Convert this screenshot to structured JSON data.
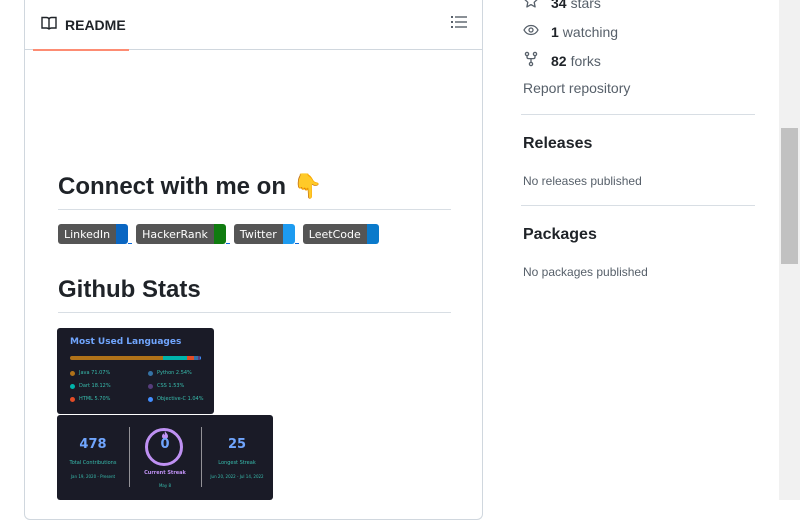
{
  "readme": {
    "tab_label": "README",
    "icons": {
      "book": "book-icon",
      "outline": "list-unordered-icon"
    }
  },
  "content": {
    "connect_heading": "Connect with me on 👇",
    "stats_heading": "Github Stats",
    "badges": [
      {
        "label": "LinkedIn",
        "color": "#0a66c2"
      },
      {
        "label": "HackerRank",
        "color": "#107c10"
      },
      {
        "label": "Twitter",
        "color": "#1d9bf0"
      },
      {
        "label": "LeetCode",
        "color": "#0a7acb"
      }
    ]
  },
  "languages_card": {
    "title": "Most Used Languages",
    "bar": [
      {
        "name": "Java",
        "percent": 71.07,
        "color": "#b07219"
      },
      {
        "name": "Dart",
        "percent": 18.12,
        "color": "#00b4ab"
      },
      {
        "name": "HTML",
        "percent": 5.7,
        "color": "#e34c26"
      },
      {
        "name": "Python",
        "percent": 2.54,
        "color": "#3572a5"
      },
      {
        "name": "CSS",
        "percent": 1.53,
        "color": "#563d7c"
      },
      {
        "name": "Objective-C",
        "percent": 1.04,
        "color": "#438eff"
      }
    ],
    "items": [
      "Java 71.07%",
      "Python 2.54%",
      "Dart 18.12%",
      "CSS 1.53%",
      "HTML 5.70%",
      "Objective-C 1.04%"
    ]
  },
  "streak_card": {
    "total": {
      "value": "478",
      "label": "Total Contributions",
      "range": "Jan 19, 2020 - Present"
    },
    "current": {
      "value": "0",
      "label": "Current Streak",
      "range": "May 8"
    },
    "longest": {
      "value": "25",
      "label": "Longest Streak",
      "range": "Jun 20, 2022 - Jul 14, 2022"
    }
  },
  "sidebar": {
    "stars": {
      "count": "34",
      "label": "stars"
    },
    "watching": {
      "count": "1",
      "label": "watching"
    },
    "forks": {
      "count": "82",
      "label": "forks"
    },
    "report_link": "Report repository",
    "releases": {
      "heading": "Releases",
      "text": "No releases published"
    },
    "packages": {
      "heading": "Packages",
      "text": "No packages published"
    }
  }
}
